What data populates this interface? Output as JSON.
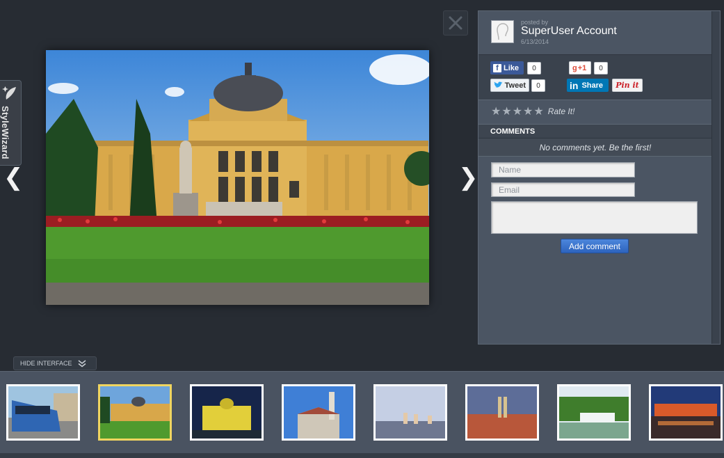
{
  "stylewizard": {
    "label": "StyleWizard"
  },
  "post": {
    "posted_by_label": "posted by",
    "user_name": "SuperUser Account",
    "date": "6/13/2014"
  },
  "social": {
    "like_label": "Like",
    "like_count": "0",
    "gplus_label": "+1",
    "gplus_count": "0",
    "tweet_label": "Tweet",
    "tweet_count": "0",
    "share_label": "Share",
    "pin_label": "Pin it"
  },
  "rating": {
    "label": "Rate It!",
    "stars": 5
  },
  "comments": {
    "header": "COMMENTS",
    "empty_text": "No comments yet. Be the first!",
    "name_placeholder": "Name",
    "email_placeholder": "Email",
    "add_button": "Add comment"
  },
  "controls": {
    "hide_interface": "HIDE INTERFACE"
  },
  "icons": {
    "close": "close-icon",
    "prev": "chevron-left-icon",
    "next": "chevron-right-icon",
    "wand": "magic-wand-icon",
    "hide": "double-chevron-down-icon"
  },
  "colors": {
    "background": "#272c33",
    "panel": "#4b5563",
    "accent_button": "#3a72cf",
    "selected_thumb_border": "#f0d560",
    "facebook": "#3b5998",
    "linkedin": "#0077b5",
    "google": "#dd4b39"
  }
}
